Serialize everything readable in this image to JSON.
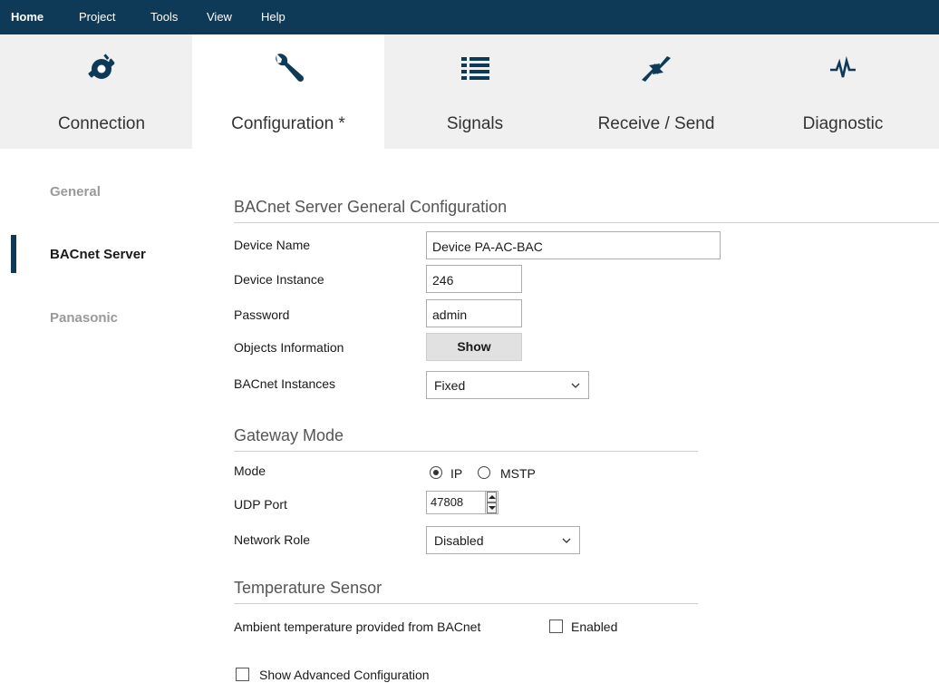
{
  "menu": {
    "home": "Home",
    "project": "Project",
    "tools": "Tools",
    "view": "View",
    "help": "Help"
  },
  "ribbon": {
    "connection": "Connection",
    "configuration": "Configuration *",
    "signals": "Signals",
    "receive_send": "Receive / Send",
    "diagnostic": "Diagnostic"
  },
  "sidebar": {
    "items": [
      {
        "label": "General"
      },
      {
        "label": "BACnet Server"
      },
      {
        "label": "Panasonic"
      }
    ]
  },
  "general_section": {
    "title": "BACnet Server General Configuration",
    "device_name_label": "Device Name",
    "device_name_value": "Device PA-AC-BAC",
    "device_instance_label": "Device Instance",
    "device_instance_value": "246",
    "password_label": "Password",
    "password_value": "admin",
    "objects_info_label": "Objects Information",
    "show_button": "Show",
    "bacnet_instances_label": "BACnet Instances",
    "bacnet_instances_value": "Fixed"
  },
  "gateway_section": {
    "title": "Gateway Mode",
    "mode_label": "Mode",
    "mode_ip": "IP",
    "mode_mstp": "MSTP",
    "udp_port_label": "UDP Port",
    "udp_port_value": "47808",
    "network_role_label": "Network Role",
    "network_role_value": "Disabled"
  },
  "temp_section": {
    "title": "Temperature Sensor",
    "ambient_label": "Ambient temperature provided from BACnet",
    "enabled_label": "Enabled"
  },
  "advanced": {
    "label": "Show Advanced Configuration"
  },
  "colors": {
    "menubar": "#0f3a57",
    "ribbon_bg": "#f0f0f0",
    "accent": "#0f3a57"
  }
}
